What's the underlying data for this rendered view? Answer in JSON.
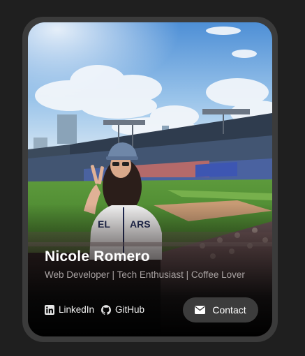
{
  "profile": {
    "name": "Nicole Romero",
    "subtitle": "Web Developer | Tech Enthusiast | Coffee Lover",
    "photo_icon": "stadium-photo"
  },
  "links": [
    {
      "label": "LinkedIn",
      "icon": "linkedin-icon"
    },
    {
      "label": "GitHub",
      "icon": "github-icon"
    }
  ],
  "contact": {
    "label": "Contact",
    "icon": "envelope-icon"
  },
  "colors": {
    "page_background": "#1f1f1f",
    "frame": "#3b3b3b",
    "button_background": "#3c3c3c",
    "subtitle_text": "#a8a2a2",
    "name_text": "#ffffff"
  }
}
